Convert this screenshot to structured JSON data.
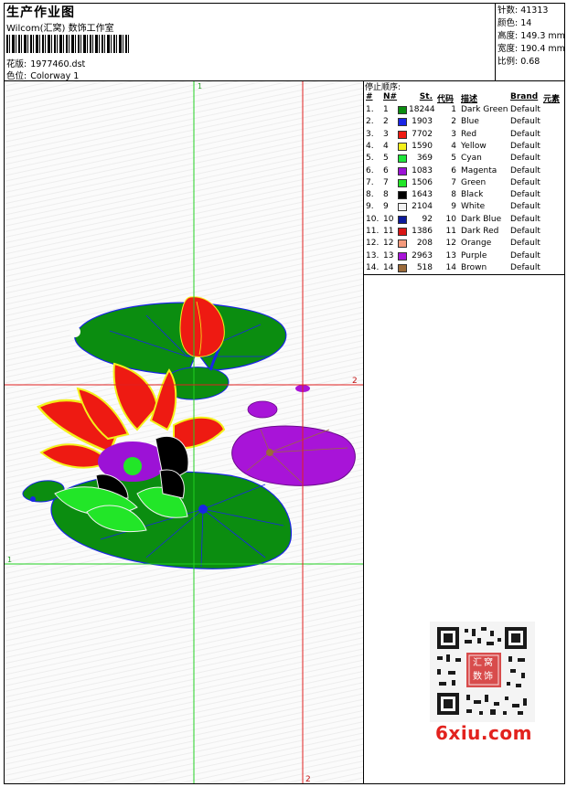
{
  "header": {
    "title": "生产作业图",
    "subtitle": "Wilcom(汇窝) 数饰工作室",
    "design_label": "花版:",
    "design_file": "1977460.dst",
    "colorway_label": "色位:",
    "colorway": "Colorway 1"
  },
  "stats": {
    "stitches_label": "针数:",
    "stitches": "41313",
    "colors_label": "颜色:",
    "colors": "14",
    "height_label": "高度:",
    "height": "149.3 mm",
    "width_label": "宽度:",
    "width": "190.4 mm",
    "scale_label": "比例:",
    "scale": "0.68"
  },
  "guides": {
    "green_v_label": "1",
    "green_h_label": "1",
    "red_v_label": "2",
    "red_h_label": "2"
  },
  "thread_table": {
    "caption": "停止顺序:",
    "headers": {
      "idx": "#",
      "num": "N#",
      "st": "St.",
      "code": "代码",
      "desc": "描述",
      "brand": "Brand",
      "elem": "元素"
    },
    "rows": [
      {
        "idx": "1.",
        "num": "1",
        "color": "#0b8d10",
        "st": "18244",
        "code": "1",
        "desc": "Dark Green",
        "brand": "Default"
      },
      {
        "idx": "2.",
        "num": "2",
        "color": "#1a25e6",
        "st": "1903",
        "code": "2",
        "desc": "Blue",
        "brand": "Default"
      },
      {
        "idx": "3.",
        "num": "3",
        "color": "#ee1a12",
        "st": "7702",
        "code": "3",
        "desc": "Red",
        "brand": "Default"
      },
      {
        "idx": "4.",
        "num": "4",
        "color": "#f4f01a",
        "st": "1590",
        "code": "4",
        "desc": "Yellow",
        "brand": "Default"
      },
      {
        "idx": "5.",
        "num": "5",
        "color": "#1ee63a",
        "st": "369",
        "code": "5",
        "desc": "Cyan",
        "brand": "Default"
      },
      {
        "idx": "6.",
        "num": "6",
        "color": "#9c12d6",
        "st": "1083",
        "code": "6",
        "desc": "Magenta",
        "brand": "Default"
      },
      {
        "idx": "7.",
        "num": "7",
        "color": "#22e628",
        "st": "1506",
        "code": "7",
        "desc": "Green",
        "brand": "Default"
      },
      {
        "idx": "8.",
        "num": "8",
        "color": "#000000",
        "st": "1643",
        "code": "8",
        "desc": "Black",
        "brand": "Default"
      },
      {
        "idx": "9.",
        "num": "9",
        "color": "#f2f2f2",
        "st": "2104",
        "code": "9",
        "desc": "White",
        "brand": "Default"
      },
      {
        "idx": "10.",
        "num": "10",
        "color": "#0c1a9a",
        "st": "92",
        "code": "10",
        "desc": "Dark Blue",
        "brand": "Default"
      },
      {
        "idx": "11.",
        "num": "11",
        "color": "#d91616",
        "st": "1386",
        "code": "11",
        "desc": "Dark Red",
        "brand": "Default"
      },
      {
        "idx": "12.",
        "num": "12",
        "color": "#f59a7c",
        "st": "208",
        "code": "12",
        "desc": "Orange",
        "brand": "Default"
      },
      {
        "idx": "13.",
        "num": "13",
        "color": "#a814d8",
        "st": "2963",
        "code": "13",
        "desc": "Purple",
        "brand": "Default"
      },
      {
        "idx": "14.",
        "num": "14",
        "color": "#9a6a3a",
        "st": "518",
        "code": "14",
        "desc": "Brown",
        "brand": "Default"
      }
    ]
  },
  "qr_seal_text": "汇窝数饰",
  "watermark": "6xiu.com"
}
